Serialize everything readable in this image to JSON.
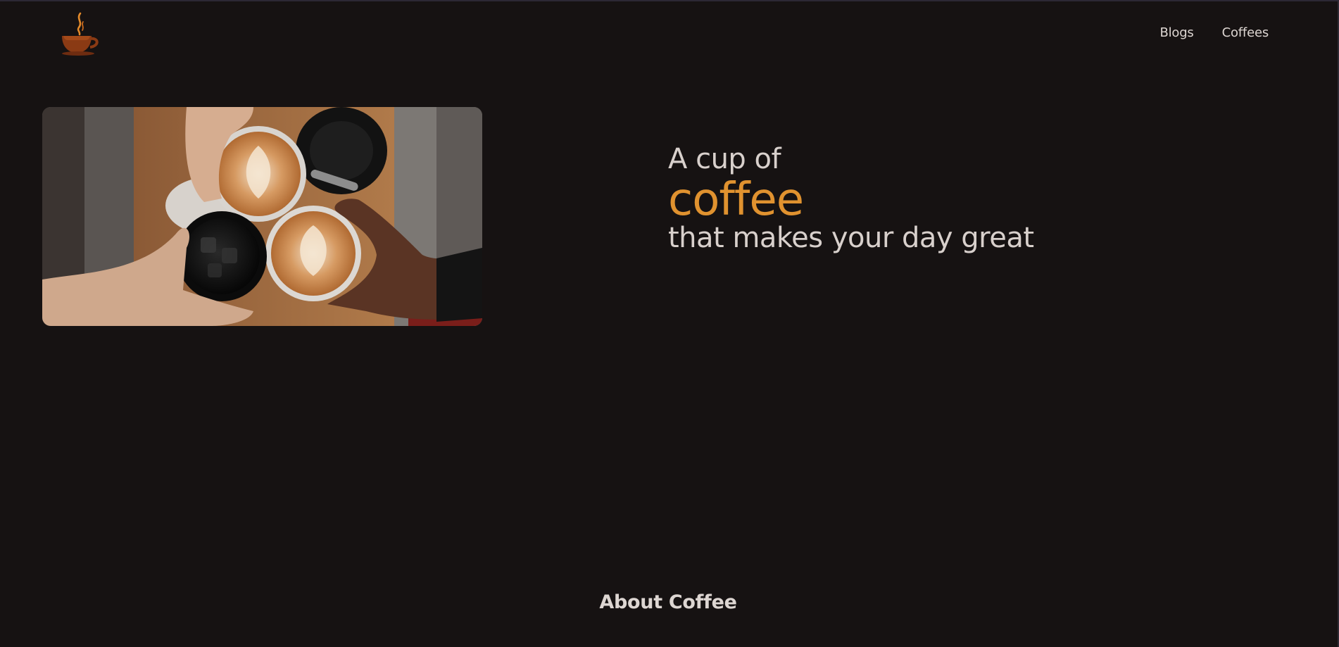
{
  "header": {
    "logo_icon": "coffee-cup-icon",
    "nav": [
      {
        "label": "Blogs"
      },
      {
        "label": "Coffees"
      }
    ]
  },
  "hero": {
    "image_alt": "Four hands toasting with latte and iced coffee cups",
    "line1": "A cup of",
    "line2": "coffee",
    "line3": "that makes your day great"
  },
  "about": {
    "heading": "About Coffee"
  },
  "colors": {
    "background": "#161212",
    "accent": "#e0922f",
    "text": "#d8d0cc"
  }
}
